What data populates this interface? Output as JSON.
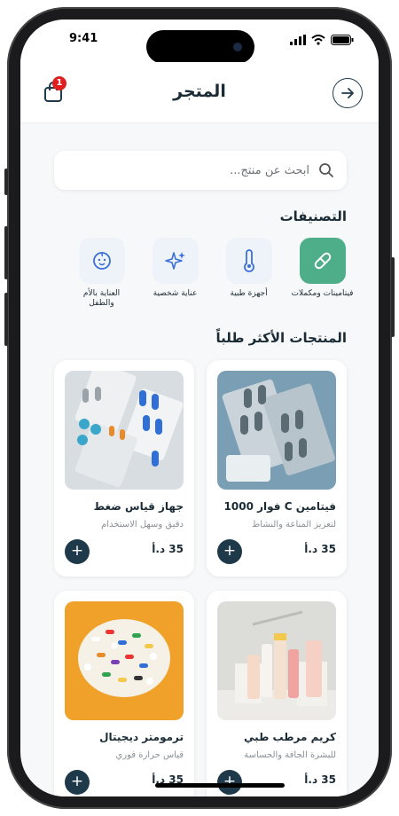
{
  "status": {
    "time": "9:41"
  },
  "header": {
    "title": "المتجر",
    "cart_count": "1"
  },
  "search": {
    "placeholder": "ابحث عن منتج..."
  },
  "categories": {
    "title": "التصنيفات",
    "items": [
      {
        "label": "فيتامينات ومكملات",
        "icon": "pill-icon",
        "active": true
      },
      {
        "label": "أجهزة طبية",
        "icon": "thermometer-icon",
        "active": false
      },
      {
        "label": "عناية شخصية",
        "icon": "sparkle-icon",
        "active": false
      },
      {
        "label": "العناية بالأم والطفل",
        "icon": "baby-face-icon",
        "active": false
      }
    ]
  },
  "products": {
    "title": "المنتجات الأكثر طلباً",
    "items": [
      {
        "name": "فيتامين C فوار 1000",
        "desc": "لتعزيز المناعة والنشاط",
        "price": "35 د.أ"
      },
      {
        "name": "جهاز قياس ضغط",
        "desc": "دقيق وسهل الاستخدام",
        "price": "35 د.أ"
      },
      {
        "name": "كريم مرطب طبي",
        "desc": "للبشرة الجافة والحساسة",
        "price": "35 د.أ"
      },
      {
        "name": "ترمومتر ديجيتال",
        "desc": "قياس حرارة فوري",
        "price": "35 د.أ"
      }
    ]
  },
  "colors": {
    "primary": "#1e3a4a",
    "accent": "#4fae8a",
    "badge": "#e02020"
  }
}
